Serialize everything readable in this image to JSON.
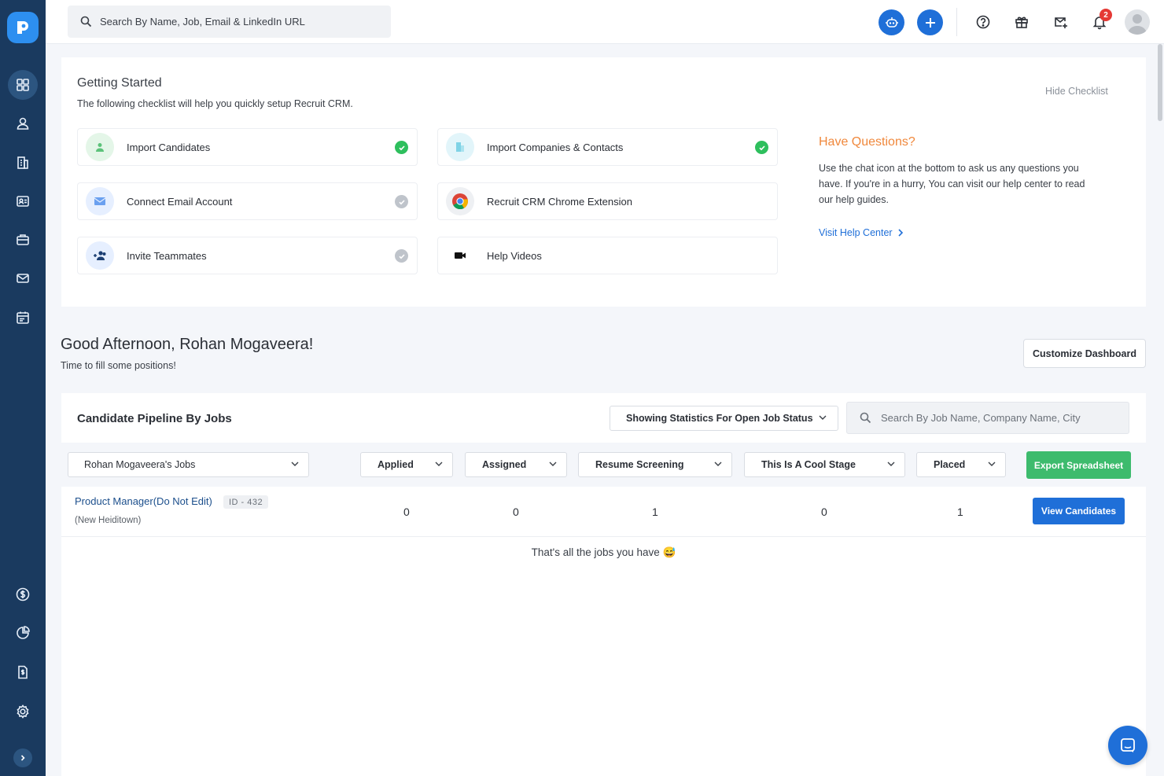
{
  "topbar": {
    "search_placeholder": "Search By Name, Job, Email & LinkedIn URL",
    "notification_count": "2"
  },
  "checklist": {
    "title": "Getting Started",
    "subtitle": "The following checklist will help you quickly setup Recruit CRM.",
    "hide_label": "Hide Checklist",
    "tasks": [
      {
        "label": "Import Candidates",
        "status": "done"
      },
      {
        "label": "Import Companies & Contacts",
        "status": "done"
      },
      {
        "label": "Connect Email Account",
        "status": "pending"
      },
      {
        "label": "Recruit CRM Chrome Extension",
        "status": "none"
      },
      {
        "label": "Invite Teammates",
        "status": "pending"
      },
      {
        "label": "Help Videos",
        "status": "none"
      }
    ],
    "help": {
      "title": "Have Questions?",
      "text": "Use the chat icon at the bottom to ask us any questions you have. If you're in a hurry, You can visit our help center to read our help guides.",
      "link": "Visit Help Center"
    }
  },
  "greeting": {
    "title": "Good Afternoon, Rohan Mogaveera!",
    "subtitle": "Time to fill some positions!",
    "customize_label": "Customize Dashboard"
  },
  "pipeline": {
    "title": "Candidate Pipeline By Jobs",
    "status_filter": "Showing Statistics For Open Job Status",
    "search_placeholder": "Search By Job Name, Company Name, City",
    "owner_filter": "Rohan Mogaveera's Jobs",
    "stages": [
      "Applied",
      "Assigned",
      "Resume Screening",
      "This Is A Cool Stage",
      "Placed"
    ],
    "export_label": "Export Spreadsheet",
    "jobs": [
      {
        "name": "Product Manager(Do Not Edit)",
        "id": "ID - 432",
        "location": "(New Heiditown)",
        "counts": [
          "0",
          "0",
          "1",
          "0",
          "1"
        ],
        "action": "View Candidates"
      }
    ],
    "footer": "That's all the jobs you have 😅"
  },
  "colors": {
    "sidebar": "#1a3a5f",
    "primary": "#1f6fd8",
    "success": "#2ebf5d",
    "accent_orange": "#f0883c",
    "export_green": "#3dbb6d"
  }
}
